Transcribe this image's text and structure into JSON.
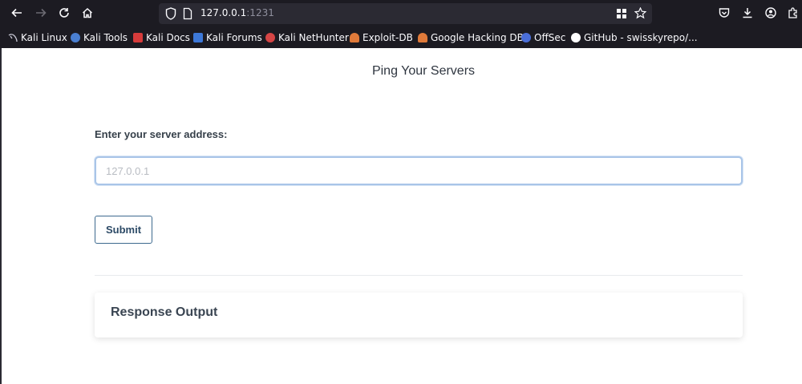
{
  "browser": {
    "url_host": "127.0.0.1",
    "url_port": ":1231",
    "nav": {
      "back": "back-arrow-icon",
      "forward": "forward-arrow-icon",
      "reload": "reload-icon",
      "home": "home-icon"
    },
    "right_icons": [
      "pocket-icon",
      "download-icon",
      "account-icon",
      "extensions-icon"
    ],
    "bookmarks": [
      {
        "label": "Kali Linux",
        "icon_color": "#3a8ee6"
      },
      {
        "label": "Kali Tools",
        "icon_color": "#4a7fd1"
      },
      {
        "label": "Kali Docs",
        "icon_color": "#d63b3b"
      },
      {
        "label": "Kali Forums",
        "icon_color": "#3d78d8"
      },
      {
        "label": "Kali NetHunter",
        "icon_color": "#d64545"
      },
      {
        "label": "Exploit-DB",
        "icon_color": "#e07a3a"
      },
      {
        "label": "Google Hacking DB",
        "icon_color": "#e07a3a"
      },
      {
        "label": "OffSec",
        "icon_color": "#4a6ed8"
      },
      {
        "label": "GitHub - swisskyrepo/...",
        "icon_color": "#ffffff"
      }
    ]
  },
  "page": {
    "title": "Ping Your Servers",
    "field_label": "Enter your server address:",
    "input_placeholder": "127.0.0.1",
    "input_value": "",
    "submit_label": "Submit",
    "response_title": "Response Output"
  }
}
